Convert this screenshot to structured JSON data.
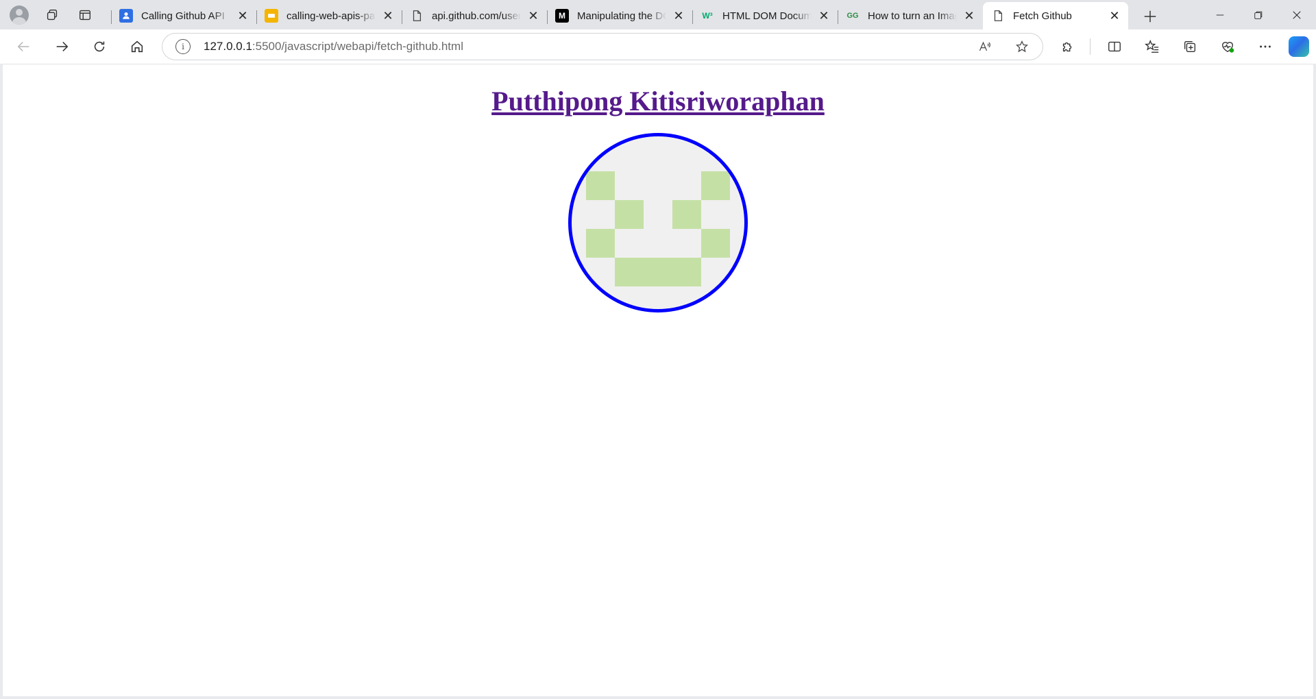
{
  "browser": {
    "tabs": [
      {
        "title": "Calling Github API",
        "favicon": "contact-icon",
        "color": "#2f6fe4",
        "active": false
      },
      {
        "title": "calling-web-apis-par",
        "favicon": "slides-icon",
        "color": "#f4b400",
        "active": false
      },
      {
        "title": "api.github.com/users",
        "favicon": "document-icon",
        "color": "#444444",
        "active": false
      },
      {
        "title": "Manipulating the DO",
        "favicon": "medium-icon",
        "color": "#000000",
        "active": false
      },
      {
        "title": "HTML DOM Docume",
        "favicon": "w3-icon",
        "color": "#04aa6d",
        "active": false
      },
      {
        "title": "How to turn an Imag",
        "favicon": "gfg-icon",
        "color": "#2f8d46",
        "active": false
      },
      {
        "title": "Fetch Github",
        "favicon": "document-icon",
        "color": "#444444",
        "active": true
      }
    ],
    "address": {
      "host": "127.0.0.1",
      "rest": ":5500/javascript/webapi/fetch-github.html"
    }
  },
  "page": {
    "name_link": "Putthipong Kitisriworaphan",
    "avatar": {
      "border_color": "#0000ff",
      "identicon_color": "#c5e0a5",
      "identicon_background": "#f0f0f0",
      "pattern": [
        [
          1,
          0,
          0,
          0,
          1
        ],
        [
          0,
          1,
          0,
          1,
          0
        ],
        [
          1,
          0,
          0,
          0,
          1
        ],
        [
          0,
          1,
          1,
          1,
          0
        ]
      ]
    }
  }
}
